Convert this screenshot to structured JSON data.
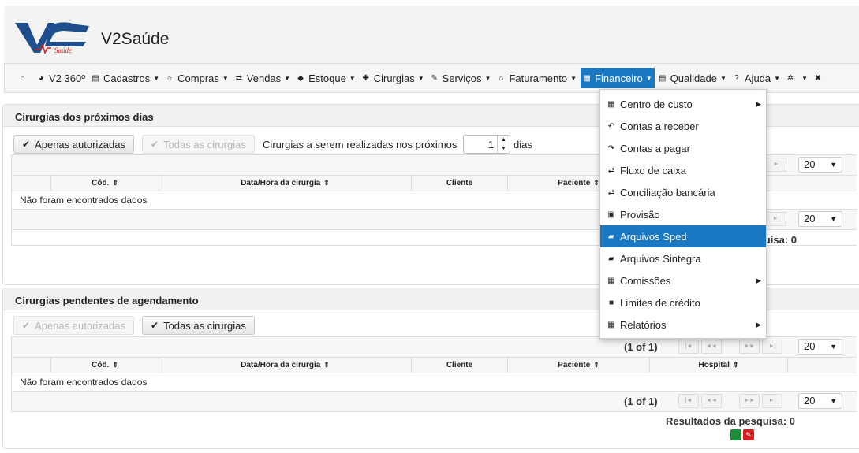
{
  "app": {
    "title": "V2Saúde",
    "logo_text": "V2 Saúde"
  },
  "menu": [
    {
      "label": "V2 360º",
      "icon": "pie-chart-icon",
      "glyph": "◕",
      "caret": false
    },
    {
      "label": "Cadastros",
      "icon": "list-icon",
      "glyph": "▤",
      "caret": true
    },
    {
      "label": "Compras",
      "icon": "bank-icon",
      "glyph": "⌂",
      "caret": true
    },
    {
      "label": "Vendas",
      "icon": "exchange-icon",
      "glyph": "⇄",
      "caret": true
    },
    {
      "label": "Estoque",
      "icon": "tag-icon",
      "glyph": "◆",
      "caret": true
    },
    {
      "label": "Cirurgias",
      "icon": "plus-circle-icon",
      "glyph": "✚",
      "caret": true
    },
    {
      "label": "Serviços",
      "icon": "wrench-icon",
      "glyph": "✎",
      "caret": true
    },
    {
      "label": "Faturamento",
      "icon": "bank-icon",
      "glyph": "⌂",
      "caret": true
    },
    {
      "label": "Financeiro",
      "icon": "table-icon",
      "glyph": "▦",
      "caret": true,
      "active": true
    },
    {
      "label": "Qualidade",
      "icon": "list-icon",
      "glyph": "▤",
      "caret": true
    },
    {
      "label": "Ajuda",
      "icon": "question-icon",
      "glyph": "?",
      "caret": true
    },
    {
      "label": "",
      "icon": "gear-icon",
      "glyph": "✲",
      "caret": true
    },
    {
      "label": "",
      "icon": "close-circle-icon",
      "glyph": "✖",
      "caret": false
    }
  ],
  "home_glyph": "⌂",
  "panel1": {
    "title": "Cirurgias dos próximos dias",
    "btn_authorized": "Apenas autorizadas",
    "btn_all": "Todas as cirurgias",
    "next_label": "Cirurgias a serem realizadas nos próximos",
    "days_value": "1",
    "days_label": "dias",
    "columns": [
      "Cód.",
      "Data/Hora da cirurgia",
      "Cliente",
      "Paciente"
    ],
    "empty": "Não foram encontrados dados",
    "rows_per_page": "20",
    "results": "Resultados da pesquisa: 0"
  },
  "panel2": {
    "title": "Cirurgias pendentes de agendamento",
    "btn_authorized": "Apenas autorizadas",
    "btn_all": "Todas as cirurgias",
    "columns": [
      "Cód.",
      "Data/Hora da cirurgia",
      "Cliente",
      "Paciente",
      "Hospital"
    ],
    "empty": "Não foram encontrados dados",
    "page_info": "(1 of 1)",
    "rows_per_page": "20",
    "results": "Resultados da pesquisa: 0"
  },
  "dropdown": [
    {
      "label": "Centro de custo",
      "icon": "table-icon",
      "glyph": "▦",
      "submenu": true
    },
    {
      "label": "Contas a receber",
      "icon": "arrow-back-icon",
      "glyph": "↶",
      "submenu": false
    },
    {
      "label": "Contas a pagar",
      "icon": "arrow-forward-icon",
      "glyph": "↷",
      "submenu": false
    },
    {
      "label": "Fluxo de caixa",
      "icon": "exchange-icon",
      "glyph": "⇄",
      "submenu": false
    },
    {
      "label": "Conciliação bancária",
      "icon": "exchange-icon",
      "glyph": "⇄",
      "submenu": false
    },
    {
      "label": "Provisão",
      "icon": "calendar-icon",
      "glyph": "▣",
      "submenu": false
    },
    {
      "label": "Arquivos Sped",
      "icon": "folder-open-icon",
      "glyph": "▰",
      "submenu": false,
      "active": true
    },
    {
      "label": "Arquivos Sintegra",
      "icon": "folder-open-icon",
      "glyph": "▰",
      "submenu": false
    },
    {
      "label": "Comissões",
      "icon": "calculator-icon",
      "glyph": "▦",
      "submenu": true
    },
    {
      "label": "Limites de crédito",
      "icon": "lock-icon",
      "glyph": "■",
      "submenu": false
    },
    {
      "label": "Relatórios",
      "icon": "table-icon",
      "glyph": "▦",
      "submenu": true
    }
  ],
  "colors": {
    "accent": "#1a78c2"
  }
}
